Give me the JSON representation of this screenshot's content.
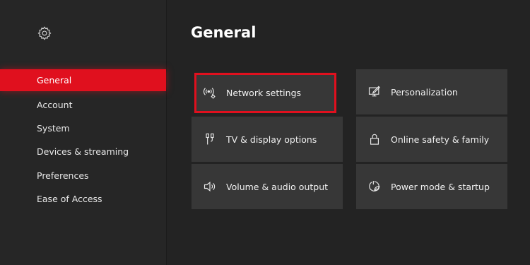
{
  "sidebar": {
    "items": [
      {
        "label": "General",
        "active": true
      },
      {
        "label": "Account",
        "active": false
      },
      {
        "label": "System",
        "active": false
      },
      {
        "label": "Devices & streaming",
        "active": false
      },
      {
        "label": "Preferences",
        "active": false
      },
      {
        "label": "Ease of Access",
        "active": false
      }
    ]
  },
  "main": {
    "title": "General",
    "tiles": [
      {
        "label": "Network settings",
        "icon": "network-icon"
      },
      {
        "label": "Personalization",
        "icon": "personalization-icon"
      },
      {
        "label": "TV & display options",
        "icon": "display-cable-icon"
      },
      {
        "label": "Online safety & family",
        "icon": "lock-icon"
      },
      {
        "label": "Volume & audio output",
        "icon": "speaker-icon"
      },
      {
        "label": "Power mode & startup",
        "icon": "power-leaf-icon"
      }
    ],
    "focused_tile": "Network settings"
  },
  "colors": {
    "accent": "#e0101e",
    "background": "#232323",
    "tile": "#373737"
  }
}
